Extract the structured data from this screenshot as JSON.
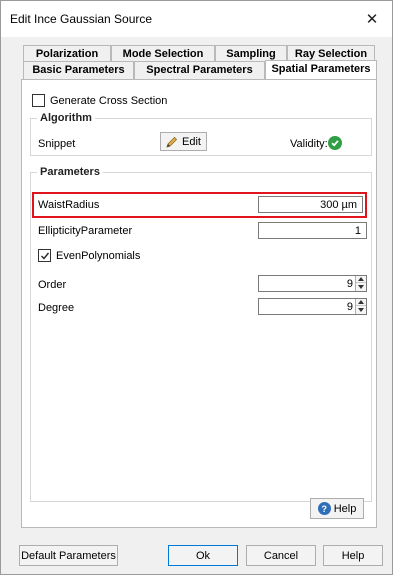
{
  "window": {
    "title": "Edit Ince Gaussian Source",
    "close_glyph": "✕"
  },
  "tabs": {
    "row1": [
      "Polarization",
      "Mode Selection",
      "Sampling",
      "Ray Selection"
    ],
    "row2": [
      "Basic Parameters",
      "Spectral Parameters",
      "Spatial Parameters"
    ],
    "active": "Spatial Parameters"
  },
  "spatial": {
    "generate_cross_section": {
      "label": "Generate Cross Section",
      "checked": false
    },
    "algorithm": {
      "legend": "Algorithm",
      "snippet_label": "Snippet",
      "edit_label": "Edit",
      "validity_label": "Validity:",
      "validity_icon": "check-circle-icon"
    },
    "parameters": {
      "legend": "Parameters",
      "waist_radius": {
        "label": "WaistRadius",
        "value": "300 µm"
      },
      "ellipticity": {
        "label": "EllipticityParameter",
        "value": "1"
      },
      "even_polynomials": {
        "label": "EvenPolynomials",
        "checked": true
      },
      "order": {
        "label": "Order",
        "value": "9"
      },
      "degree": {
        "label": "Degree",
        "value": "9"
      }
    },
    "help_label": "Help"
  },
  "footer": {
    "default_parameters": "Default Parameters",
    "ok": "Ok",
    "cancel": "Cancel",
    "help": "Help"
  },
  "colors": {
    "highlight": "#e0151c",
    "valid": "#2f9e44",
    "help_icon": "#2f6fb8"
  }
}
